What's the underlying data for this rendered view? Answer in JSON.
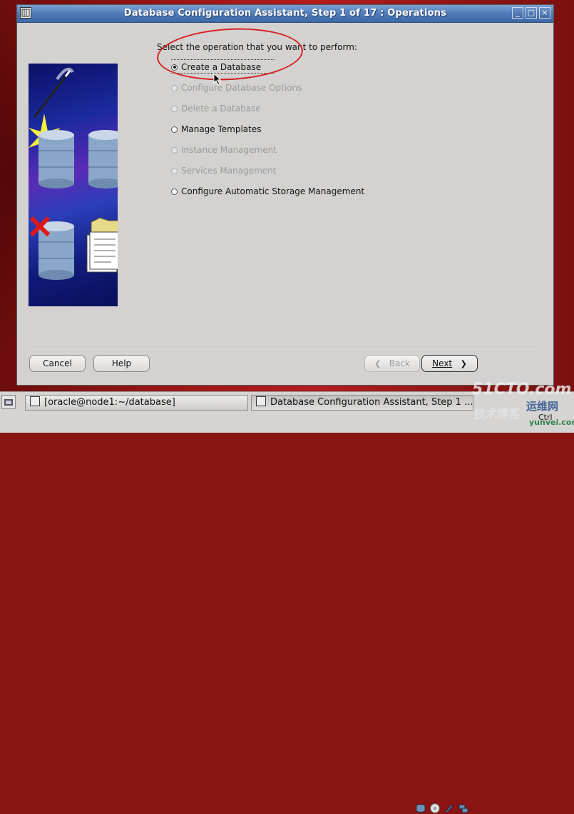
{
  "window": {
    "title": "Database Configuration Assistant, Step 1 of 17 : Operations",
    "controls": {
      "minimize": "_",
      "maximize": "□",
      "close": "×"
    }
  },
  "prompt": "Select the operation that you want to perform:",
  "operations": [
    {
      "label": "Create a Database",
      "selected": true,
      "enabled": true
    },
    {
      "label": "Configure Database Options",
      "selected": false,
      "enabled": false
    },
    {
      "label": "Delete a Database",
      "selected": false,
      "enabled": false
    },
    {
      "label": "Manage Templates",
      "selected": false,
      "enabled": true
    },
    {
      "label": "Instance Management",
      "selected": false,
      "enabled": false
    },
    {
      "label": "Services Management",
      "selected": false,
      "enabled": false
    },
    {
      "label": "Configure Automatic Storage Management",
      "selected": false,
      "enabled": true
    }
  ],
  "buttons": {
    "cancel": "Cancel",
    "help": "Help",
    "back": "Back",
    "next": "Next",
    "back_enabled": false
  },
  "taskbar": {
    "tasks": [
      {
        "label": "[oracle@node1:~/database]"
      },
      {
        "label": "Database Configuration Assistant, Step 1 ..."
      }
    ],
    "tray_text": "Ctrl"
  },
  "watermark": {
    "line1": "51CTO.com",
    "line2": "技术博客",
    "line3": "运维网",
    "line4": "yunvei.com"
  },
  "colors": {
    "titlebar": "#4f7bb8",
    "annotation": "#d42020",
    "desktop": "#9a1616"
  }
}
